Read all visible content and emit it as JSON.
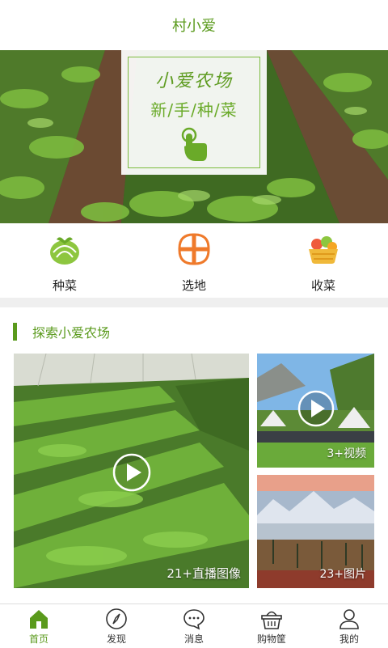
{
  "header": {
    "title": "村小爱"
  },
  "banner": {
    "title": "小爱农场",
    "subtitle": "新/手/种/菜",
    "dots": 4,
    "active_dot": 1
  },
  "quick_actions": [
    {
      "label": "种菜",
      "icon": "cabbage-icon"
    },
    {
      "label": "选地",
      "icon": "land-plot-icon"
    },
    {
      "label": "收菜",
      "icon": "vegetable-basket-icon"
    }
  ],
  "explore": {
    "title": "探索小爱农场",
    "tiles": [
      {
        "caption": "21+直播图像"
      },
      {
        "caption": "3+视频"
      },
      {
        "caption": "23+图片"
      }
    ]
  },
  "tabbar": [
    {
      "label": "首页",
      "icon": "home-icon",
      "active": true
    },
    {
      "label": "发现",
      "icon": "compass-icon",
      "active": false
    },
    {
      "label": "消息",
      "icon": "message-icon",
      "active": false
    },
    {
      "label": "购物筐",
      "icon": "basket-icon",
      "active": false
    },
    {
      "label": "我的",
      "icon": "user-icon",
      "active": false
    }
  ],
  "colors": {
    "brand": "#5a9a1c",
    "accent_orange": "#ef7a2b"
  }
}
